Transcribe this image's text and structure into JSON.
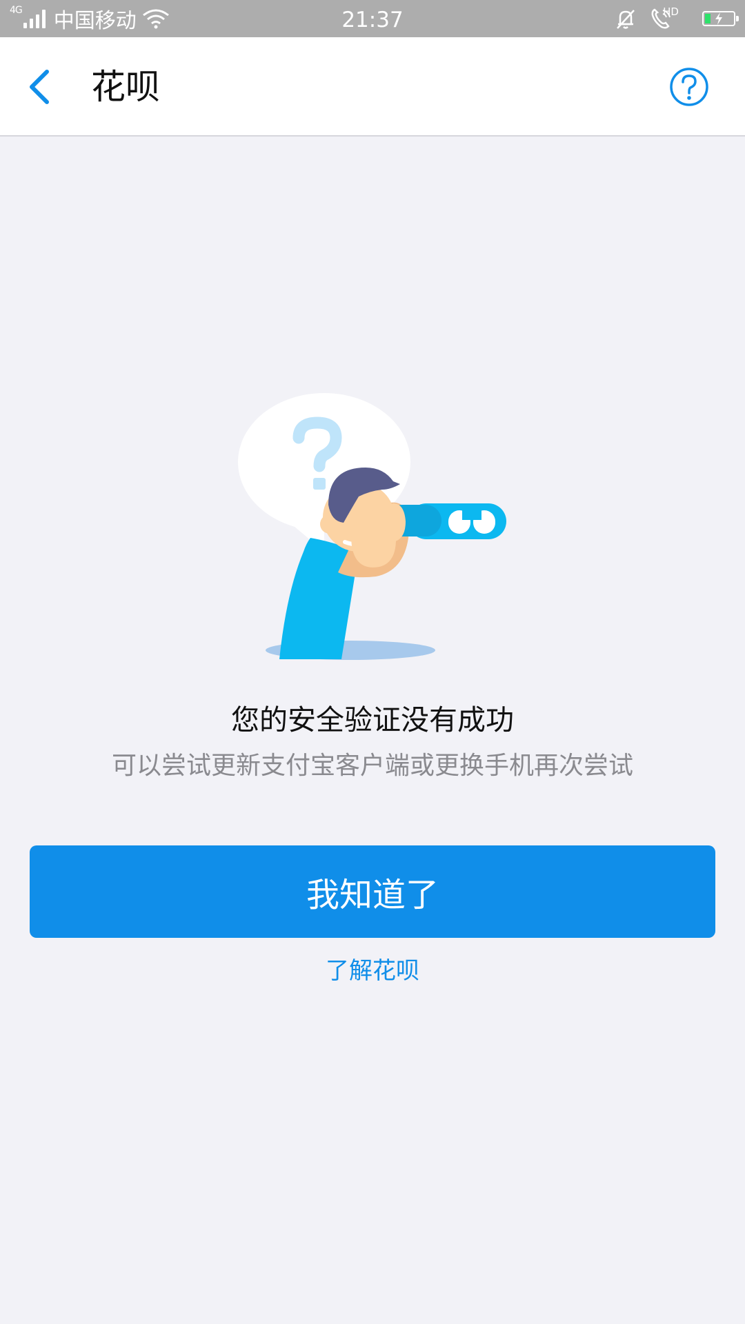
{
  "status_bar": {
    "network": "4G",
    "carrier": "中国移动",
    "time": "21:37",
    "hd_label": "HD",
    "battery_level": 0.2,
    "icons": [
      "signal-icon",
      "wifi-icon",
      "mute-bell-icon",
      "hd-call-icon",
      "battery-icon"
    ]
  },
  "nav": {
    "title": "花呗",
    "back_icon": "chevron-left-icon",
    "help_icon": "question-circle-icon"
  },
  "message": {
    "title": "您的安全验证没有成功",
    "subtitle": "可以尝试更新支付宝客户端或更换手机再次尝试"
  },
  "actions": {
    "primary_label": "我知道了",
    "link_label": "了解花呗"
  },
  "colors": {
    "accent": "#108ee9",
    "background": "#f2f2f7",
    "status_bar": "#adadad",
    "battery": "#2ee16a"
  }
}
